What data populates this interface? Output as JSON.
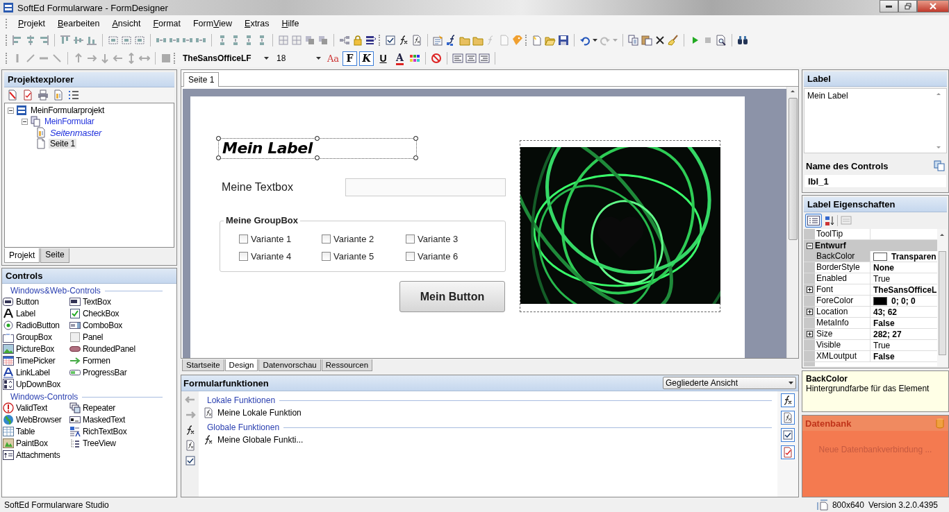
{
  "window": {
    "title": "SoftEd Formularware - FormDesigner"
  },
  "menu": [
    {
      "key": "P",
      "post": "rojekt"
    },
    {
      "key": "B",
      "post": "earbeiten"
    },
    {
      "key": "A",
      "post": "nsicht"
    },
    {
      "key": "F",
      "post": "ormat"
    },
    {
      "pre": "Form",
      "key": "V",
      "post": "iew"
    },
    {
      "key": "E",
      "post": "xtras"
    },
    {
      "key": "H",
      "post": "ilfe"
    }
  ],
  "format_toolbar": {
    "font": "TheSansOfficeLF",
    "size": "18",
    "grow_font": "Aa",
    "buttons": [
      {
        "text": "F",
        "kind": "bold",
        "on": true
      },
      {
        "text": "K",
        "kind": "italic",
        "on": true
      },
      {
        "text": "U",
        "kind": "underline",
        "on": false
      },
      {
        "text": "A",
        "kind": "color",
        "on": false
      }
    ]
  },
  "explorer": {
    "title": "Projektexplorer",
    "tree": [
      {
        "label": "MeinFormularprojekt",
        "kind": "project",
        "selected": false,
        "expanded": true,
        "children": [
          {
            "label": "MeinFormular",
            "kind": "form",
            "selected": false,
            "expanded": true,
            "children": [
              {
                "label": "Seitenmaster",
                "kind": "master",
                "selected": false
              },
              {
                "label": "Seite 1",
                "kind": "page",
                "selected": true
              }
            ]
          }
        ]
      }
    ],
    "tabs": [
      {
        "label": "Projekt",
        "selected": true
      },
      {
        "label": "Seite",
        "selected": false
      }
    ]
  },
  "controls": {
    "title": "Controls",
    "sections": [
      {
        "title": "Windows&Web-Controls",
        "items": [
          "Button",
          "TextBox",
          "Label",
          "CheckBox",
          "RadioButton",
          "ComboBox",
          "GroupBox",
          "Panel",
          "PictureBox",
          "RoundedPanel",
          "TimePicker",
          "Formen",
          "LinkLabel",
          "ProgressBar",
          "UpDownBox"
        ]
      },
      {
        "title": "Windows-Controls",
        "items": [
          "ValidText",
          "Repeater",
          "WebBrowser",
          "MaskedText",
          "Table",
          "RichTextBox",
          "PaintBox",
          "TreeView",
          "Attachments"
        ]
      }
    ]
  },
  "document_tabs": [
    {
      "label": "Seite 1",
      "selected": true
    }
  ],
  "form": {
    "label": {
      "text": "Mein Label",
      "selected": true
    },
    "textbox": {
      "label": "Meine Textbox"
    },
    "groupbox": {
      "title": "Meine GroupBox",
      "options": [
        {
          "label": "Variante 1",
          "checked": false
        },
        {
          "label": "Variante 2",
          "checked": false
        },
        {
          "label": "Variante 3",
          "checked": false
        },
        {
          "label": "Variante 4",
          "checked": false
        },
        {
          "label": "Variante 5",
          "checked": false
        },
        {
          "label": "Variante 6",
          "checked": false
        }
      ]
    },
    "button": {
      "label": "Mein Button"
    }
  },
  "view_tabs": [
    {
      "label": "Startseite",
      "selected": false
    },
    {
      "label": "Design",
      "selected": true
    },
    {
      "label": "Datenvorschau",
      "selected": false
    },
    {
      "label": "Ressourcen",
      "selected": false
    }
  ],
  "functions": {
    "title": "Formularfunktionen",
    "view": "Gegliederte Ansicht",
    "sections": [
      {
        "title": "Lokale Funktionen",
        "kind": "local",
        "items": [
          "Meine Lokale Funktion"
        ]
      },
      {
        "title": "Globale Funktionen",
        "kind": "global",
        "items": [
          "Meine Globale Funkti..."
        ]
      }
    ]
  },
  "label_panel": {
    "title": "Label",
    "text": "Mein Label",
    "name_heading": "Name des Controls",
    "name": "lbl_1"
  },
  "properties": {
    "title": "Label Eigenschaften",
    "rows": [
      {
        "kind": "prop",
        "name": "ToolTip",
        "selected": false
      },
      {
        "kind": "category",
        "name": "Entwurf",
        "expanded": true
      },
      {
        "kind": "prop",
        "name": "BackColor",
        "value": "Transparen",
        "color": "#ffffff",
        "bold": true,
        "selected": true
      },
      {
        "kind": "prop",
        "name": "BorderStyle",
        "value": "None",
        "bold": true,
        "selected": false
      },
      {
        "kind": "prop",
        "name": "Enabled",
        "value": "True",
        "bold": false,
        "selected": false
      },
      {
        "kind": "prop",
        "name": "Font",
        "value": "TheSansOfficeL",
        "bold": true,
        "expanded": false,
        "selected": false
      },
      {
        "kind": "prop",
        "name": "ForeColor",
        "value": "0; 0; 0",
        "color": "#000000",
        "bold": true,
        "selected": false
      },
      {
        "kind": "prop",
        "name": "Location",
        "value": "43; 62",
        "bold": true,
        "expanded": false,
        "selected": false
      },
      {
        "kind": "prop",
        "name": "MetaInfo",
        "value": "False",
        "bold": true,
        "selected": false
      },
      {
        "kind": "prop",
        "name": "Size",
        "value": "282; 27",
        "bold": true,
        "expanded": false,
        "selected": false
      },
      {
        "kind": "prop",
        "name": "Visible",
        "value": "True",
        "bold": false,
        "selected": false
      },
      {
        "kind": "prop",
        "name": "XMLoutput",
        "value": "False",
        "bold": true,
        "selected": false
      }
    ]
  },
  "help": {
    "title": "BackColor",
    "text": "Hintergrundfarbe für das Element"
  },
  "database": {
    "title": "Datenbank",
    "hint": "Neue Datenbankverbindung ..."
  },
  "status_bar": {
    "left": "SoftEd Formularware Studio",
    "size": "800x640",
    "version": "Version 3.2.0.4395"
  }
}
